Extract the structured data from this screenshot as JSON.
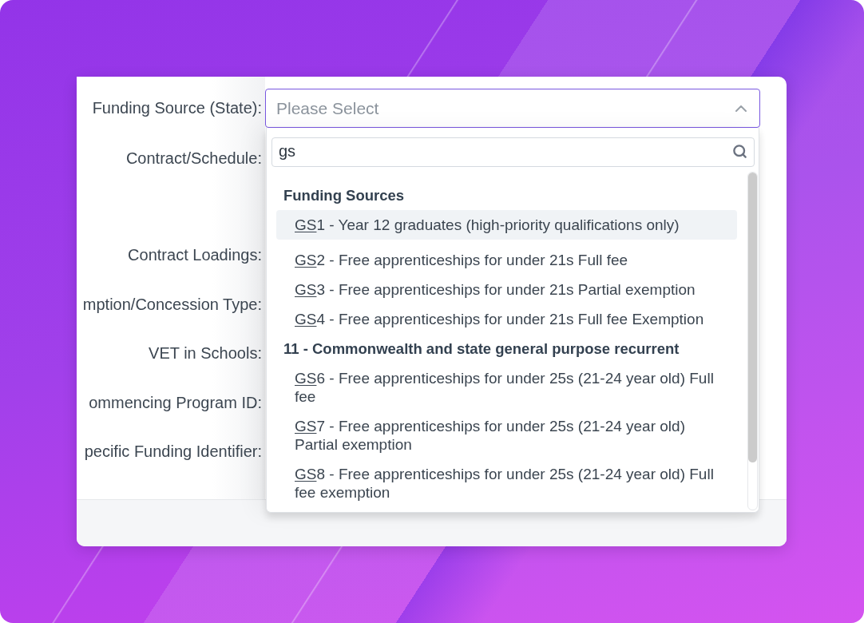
{
  "form": {
    "labels": [
      "Funding Source (State):",
      "Contract/Schedule:",
      "Contract Loadings:",
      "mption/Concession Type:",
      "VET in Schools:",
      "ommencing Program ID:",
      "pecific Funding Identifier:"
    ]
  },
  "select": {
    "placeholder": "Please Select",
    "expanded": true
  },
  "dropdown": {
    "search": {
      "value": "gs"
    },
    "groups": [
      {
        "heading": "Funding Sources",
        "options": [
          {
            "match": "GS",
            "rest": "1 - Year 12 graduates (high-priority qualifications only)",
            "selected": true
          },
          {
            "match": "GS",
            "rest": "2 - Free apprenticeships for under 21s Full fee",
            "selected": false
          },
          {
            "match": "GS",
            "rest": "3 - Free apprenticeships for under 21s Partial exemption",
            "selected": false
          },
          {
            "match": "GS",
            "rest": "4 - Free apprenticeships for under 21s Full fee Exemption",
            "selected": false
          }
        ]
      },
      {
        "heading": "11 - Commonwealth and state general purpose recurrent",
        "options": [
          {
            "match": "GS",
            "rest": "6 - Free apprenticeships for under 25s (21-24 year old) Full fee",
            "selected": false
          },
          {
            "match": "GS",
            "rest": "7 - Free apprenticeships for under 25s (21-24 year old) Partial exemption",
            "selected": false
          },
          {
            "match": "GS",
            "rest": "8 - Free apprenticeships for under 25s (21-24 year old) Full fee exemption",
            "selected": false
          }
        ]
      }
    ]
  }
}
